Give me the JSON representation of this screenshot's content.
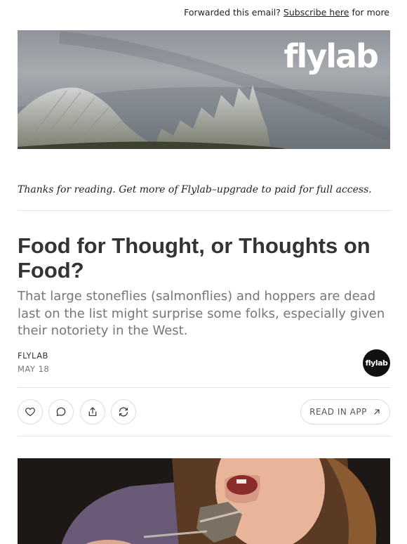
{
  "topbar": {
    "prefix": "Forwarded this email?",
    "link": "Subscribe here",
    "suffix": "for more"
  },
  "hero": {
    "logo": "flylab",
    "image_icon": "fish-fin-photo"
  },
  "intro": {
    "thanks": "Thanks for reading. Get more of Flylab–upgrade to paid for full access."
  },
  "post": {
    "title": "Food for Thought, or Thoughts on Food?",
    "subtitle": "That large stoneflies (salmonflies) and hoppers are dead last on the list might surprise some folks, especially given their notoriety in the West.",
    "author": "FLYLAB",
    "date": "MAY 18",
    "avatar_text": "flylab"
  },
  "actions": {
    "like_icon": "heart-icon",
    "comment_icon": "comment-icon",
    "share_icon": "share-icon",
    "restack_icon": "restack-icon",
    "read_in_app": "READ IN APP",
    "read_icon": "arrow-up-right-icon"
  },
  "colors": {
    "text": "#222222",
    "subtitle": "#777777",
    "border": "#dddddd",
    "avatar_bg": "#111111"
  }
}
